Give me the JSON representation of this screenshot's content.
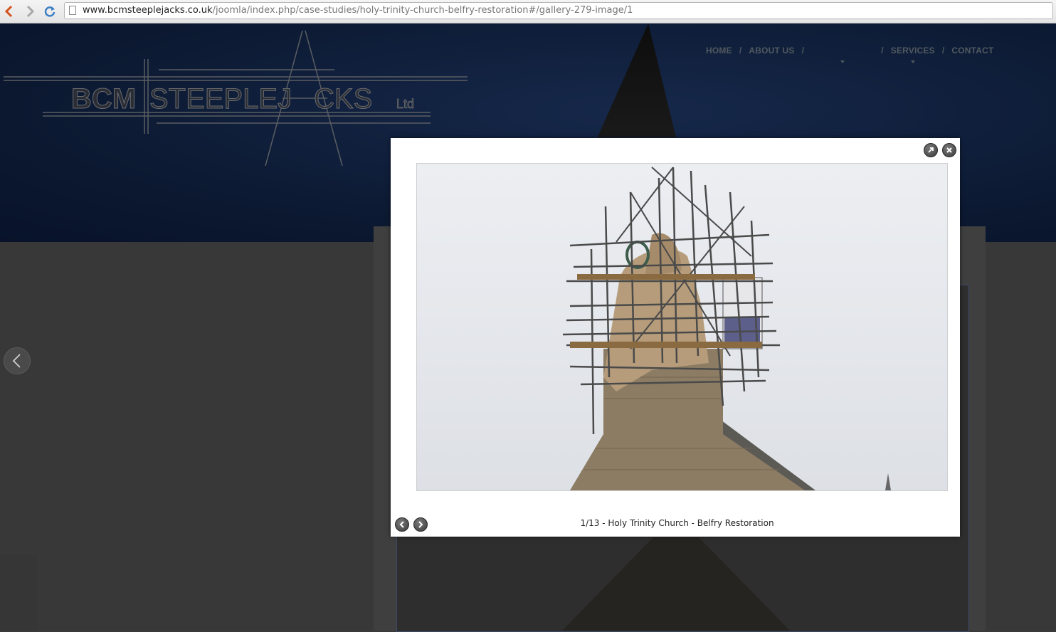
{
  "browser": {
    "url_host": "www.bcmsteeplejacks.co.uk",
    "url_path": "/joomla/index.php/case-studies/holy-trinity-church-belfry-restoration#/gallery-279-image/1"
  },
  "logo": {
    "text_left": "BCM",
    "text_mid": "STEEPLEJ",
    "text_right": "CKS",
    "suffix": "Ltd"
  },
  "nav": {
    "items": [
      {
        "label": "HOME",
        "has_dropdown": false
      },
      {
        "label": "ABOUT US",
        "has_dropdown": false
      },
      {
        "label": "",
        "has_dropdown": true
      },
      {
        "label": "SERVICES",
        "has_dropdown": true
      },
      {
        "label": "CONTACT",
        "has_dropdown": false
      }
    ],
    "separator": "/"
  },
  "lightbox": {
    "caption": "1/13 - Holy Trinity Church - Belfry Restoration",
    "current_image": 1,
    "total_images": 13,
    "buttons": [
      "expand-icon",
      "close-icon",
      "prev-icon",
      "next-icon"
    ]
  },
  "colors": {
    "header_bg": "#0b1830",
    "overlay_page": "#383838",
    "lightbox_bg": "#ffffff"
  }
}
